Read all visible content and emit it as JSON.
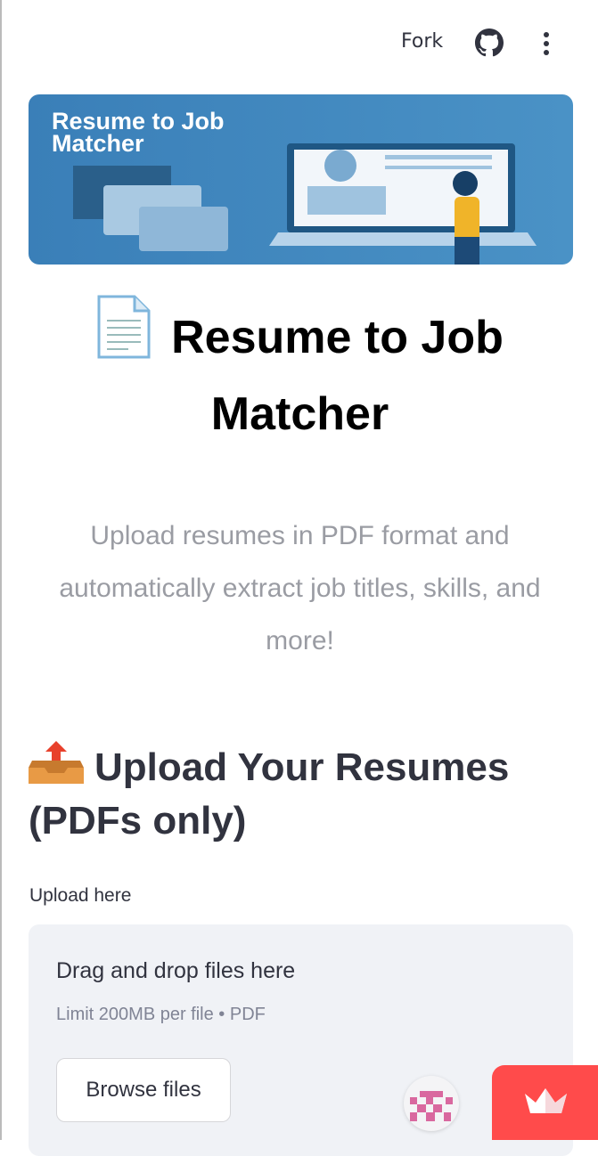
{
  "header": {
    "fork_label": "Fork",
    "icons": [
      "github-icon",
      "more-vertical-icon"
    ]
  },
  "banner": {
    "text": "Resume to Job Matcher",
    "line1": "Resume to Job",
    "line2": "Matcher"
  },
  "title": {
    "icon": "page-facing-up-emoji",
    "text": "Resume to Job Matcher"
  },
  "subtitle": "Upload resumes in PDF format and automatically extract job titles, skills, and more!",
  "upload": {
    "heading_icon": "outbox-tray-emoji",
    "heading": "Upload Your Resumes (PDFs only)",
    "label": "Upload here",
    "dropzone_title": "Drag and drop files here",
    "dropzone_limit": "Limit 200MB per file • PDF",
    "browse_label": "Browse files"
  },
  "colors": {
    "accent": "#ff4b4b",
    "banner": "#3f87bd",
    "dropzone": "#f0f2f6"
  }
}
